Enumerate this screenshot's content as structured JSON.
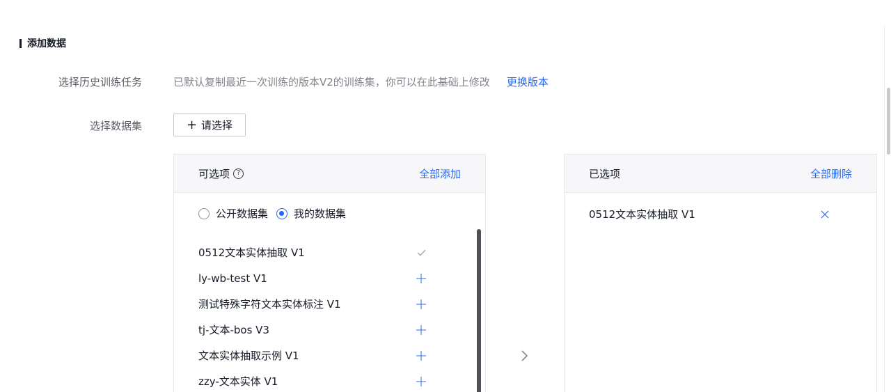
{
  "section": {
    "title": "添加数据"
  },
  "history": {
    "label": "选择历史训练任务",
    "description": "已默认复制最近一次训练的版本V2的训练集，你可以在此基础上修改",
    "link": "更换版本"
  },
  "dataset": {
    "label": "选择数据集",
    "select_button": "请选择",
    "select_icon": "plus-icon"
  },
  "available": {
    "title": "可选项",
    "help_icon": "question-circle-icon",
    "add_all": "全部添加",
    "radios": [
      {
        "label": "公开数据集",
        "checked": false
      },
      {
        "label": "我的数据集",
        "checked": true
      }
    ],
    "items": [
      {
        "name": "0512文本实体抽取 V1",
        "state": "added",
        "icon": "check-icon"
      },
      {
        "name": "ly-wb-test V1",
        "state": "available",
        "icon": "plus-icon"
      },
      {
        "name": "测试特殊字符文本实体标注 V1",
        "state": "available",
        "icon": "plus-icon"
      },
      {
        "name": "tj-文本-bos V3",
        "state": "available",
        "icon": "plus-icon"
      },
      {
        "name": "文本实体抽取示例 V1",
        "state": "available",
        "icon": "plus-icon"
      },
      {
        "name": "zzy-文本实体 V1",
        "state": "available",
        "icon": "plus-icon"
      }
    ]
  },
  "selected": {
    "title": "已选项",
    "delete_all": "全部删除",
    "items": [
      {
        "name": "0512文本实体抽取 V1",
        "icon": "close-icon"
      }
    ]
  },
  "colors": {
    "accent": "#2468f2",
    "text": "#151a26",
    "muted": "#84868c",
    "check": "#a3a6ad"
  }
}
